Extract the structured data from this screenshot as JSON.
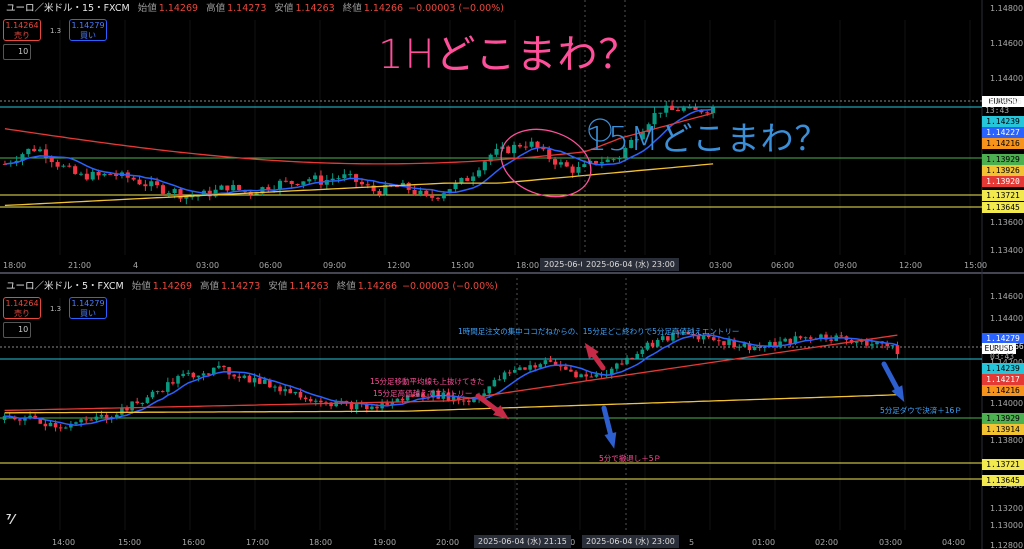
{
  "panels": [
    {
      "symbol": "ユーロ／米ドル・15・FXCM",
      "open_label": "始値",
      "open": "1.14269",
      "high_label": "高値",
      "high": "1.14273",
      "low_label": "安値",
      "low": "1.14263",
      "close_label": "終値",
      "close": "1.14266",
      "change": "−0.00003 (−0.00%)",
      "sell_price": "1.14264",
      "sell_label": "売り",
      "spread": "1.3",
      "buy_price": "1.14279",
      "buy_label": "買い",
      "lot": "10",
      "sym_tag": "EURUSD",
      "last_price": "1.14266",
      "countdown": "13:43",
      "price_tags": [
        "1.14239",
        "1.14227",
        "1.14216",
        "1.13929",
        "1.13926",
        "1.13920",
        "1.13721",
        "1.13645"
      ],
      "y_ticks": [
        "1.14800",
        "1.14600",
        "1.14400",
        "1.13600",
        "1.13400"
      ],
      "x_ticks": [
        "18:00",
        "21:00",
        "4",
        "03:00",
        "06:00",
        "09:00",
        "12:00",
        "15:00",
        "18:00",
        "03:00",
        "06:00",
        "09:00",
        "12:00",
        "15:00"
      ],
      "x_highlights": [
        "2025-06-0",
        "2025-06-04 (水)   23:00"
      ],
      "handwritten": [
        "1Hどこまわ？",
        "15Mどこまわ？"
      ]
    },
    {
      "symbol": "ユーロ／米ドル・5・FXCM",
      "open_label": "始値",
      "open": "1.14269",
      "high_label": "高値",
      "high": "1.14273",
      "low_label": "安値",
      "low": "1.14263",
      "close_label": "終値",
      "close": "1.14266",
      "change": "−0.00003 (−0.00%)",
      "sell_price": "1.14264",
      "sell_label": "売り",
      "spread": "1.3",
      "buy_price": "1.14279",
      "buy_label": "買い",
      "lot": "10",
      "sym_tag": "EURUSD",
      "last_price": "1.14266",
      "countdown": "03:43",
      "price_tags": [
        "1.14279",
        "1.14239",
        "1.14217",
        "1.14216",
        "1.13929",
        "1.13914",
        "1.13721",
        "1.13645"
      ],
      "y_ticks": [
        "1.14600",
        "1.14400",
        "1.14200",
        "1.14000",
        "1.13800",
        "1.13600",
        "1.13400",
        "1.13200",
        "1.13000",
        "1.12800"
      ],
      "x_ticks": [
        "14:00",
        "15:00",
        "16:00",
        "17:00",
        "18:00",
        "19:00",
        "20:00",
        "00",
        "5",
        "01:00",
        "02:00",
        "03:00",
        "04:00"
      ],
      "x_highlights": [
        "2025-06-04 (水)   21:15",
        "2025-06-04 (水)   23:00"
      ],
      "annotations": [
        "1時間足注文の集中ココだねからの、15分足どこ終わりで5分足高値越えエントリー",
        "15分足移動平均線も上抜けてきた",
        "15分足高値越えでエントリー",
        "5分で撤退し＋5Ｐ",
        "5分足ダウで決済＋16Ｐ"
      ]
    }
  ],
  "colors": {
    "up": "#089981",
    "down": "#f23645",
    "ma_fast": "#2962ff",
    "ma_mid": "#e53935",
    "ma_slow": "#f2c232",
    "ann_pink": "#ff4f9a",
    "ann_blue": "#3da5ff"
  },
  "chart_data": [
    {
      "type": "candlestick",
      "title": "ユーロ／米ドル・15・FXCM",
      "ylim": [
        1.1335,
        1.1482
      ],
      "y_ticks": [
        1.148,
        1.146,
        1.144,
        1.136,
        1.134
      ],
      "candle_count": 122,
      "ohlc_path": [
        1.1392,
        1.1396,
        1.14,
        1.1402,
        1.1398,
        1.1392,
        1.1388,
        1.1384,
        1.1385,
        1.1384,
        1.1386,
        1.1384,
        1.1383,
        1.138,
        1.1378,
        1.1376,
        1.1375,
        1.1372,
        1.1372,
        1.1373,
        1.1375,
        1.1378,
        1.1376,
        1.1374,
        1.1376,
        1.1378,
        1.138,
        1.138,
        1.1382,
        1.1383,
        1.1381,
        1.1383,
        1.1384,
        1.1382,
        1.1378,
        1.1375,
        1.1376,
        1.1378,
        1.1377,
        1.1374,
        1.137,
        1.1373,
        1.1377,
        1.138,
        1.1384,
        1.1392,
        1.1398,
        1.14,
        1.1402,
        1.1405,
        1.1404,
        1.1398,
        1.1394,
        1.139,
        1.1388,
        1.139,
        1.1394,
        1.1394,
        1.1396,
        1.1404,
        1.1412,
        1.142,
        1.1426,
        1.1425,
        1.1427,
        1.1424,
        1.1426,
        1.1427
      ],
      "moving_averages": [
        {
          "name": "MA fast",
          "color": "#2962ff"
        },
        {
          "name": "MA mid",
          "color": "#e53935"
        },
        {
          "name": "MA slow",
          "color": "#f2c232"
        }
      ],
      "horizontal_lines": [
        1.14266,
        1.14239,
        1.13929,
        1.13721,
        1.13645
      ]
    },
    {
      "type": "candlestick",
      "title": "ユーロ／米ドル・5・FXCM",
      "ylim": [
        1.1278,
        1.1472
      ],
      "y_ticks": [
        1.146,
        1.144,
        1.142,
        1.14,
        1.138,
        1.136,
        1.134,
        1.132,
        1.13,
        1.128
      ],
      "candle_count": 176,
      "moving_averages": [
        {
          "name": "MA fast",
          "color": "#2962ff"
        },
        {
          "name": "MA mid",
          "color": "#e53935"
        },
        {
          "name": "MA slow",
          "color": "#f2c232"
        }
      ],
      "horizontal_lines": [
        1.14266,
        1.14239,
        1.13929,
        1.13721,
        1.13645
      ]
    }
  ]
}
